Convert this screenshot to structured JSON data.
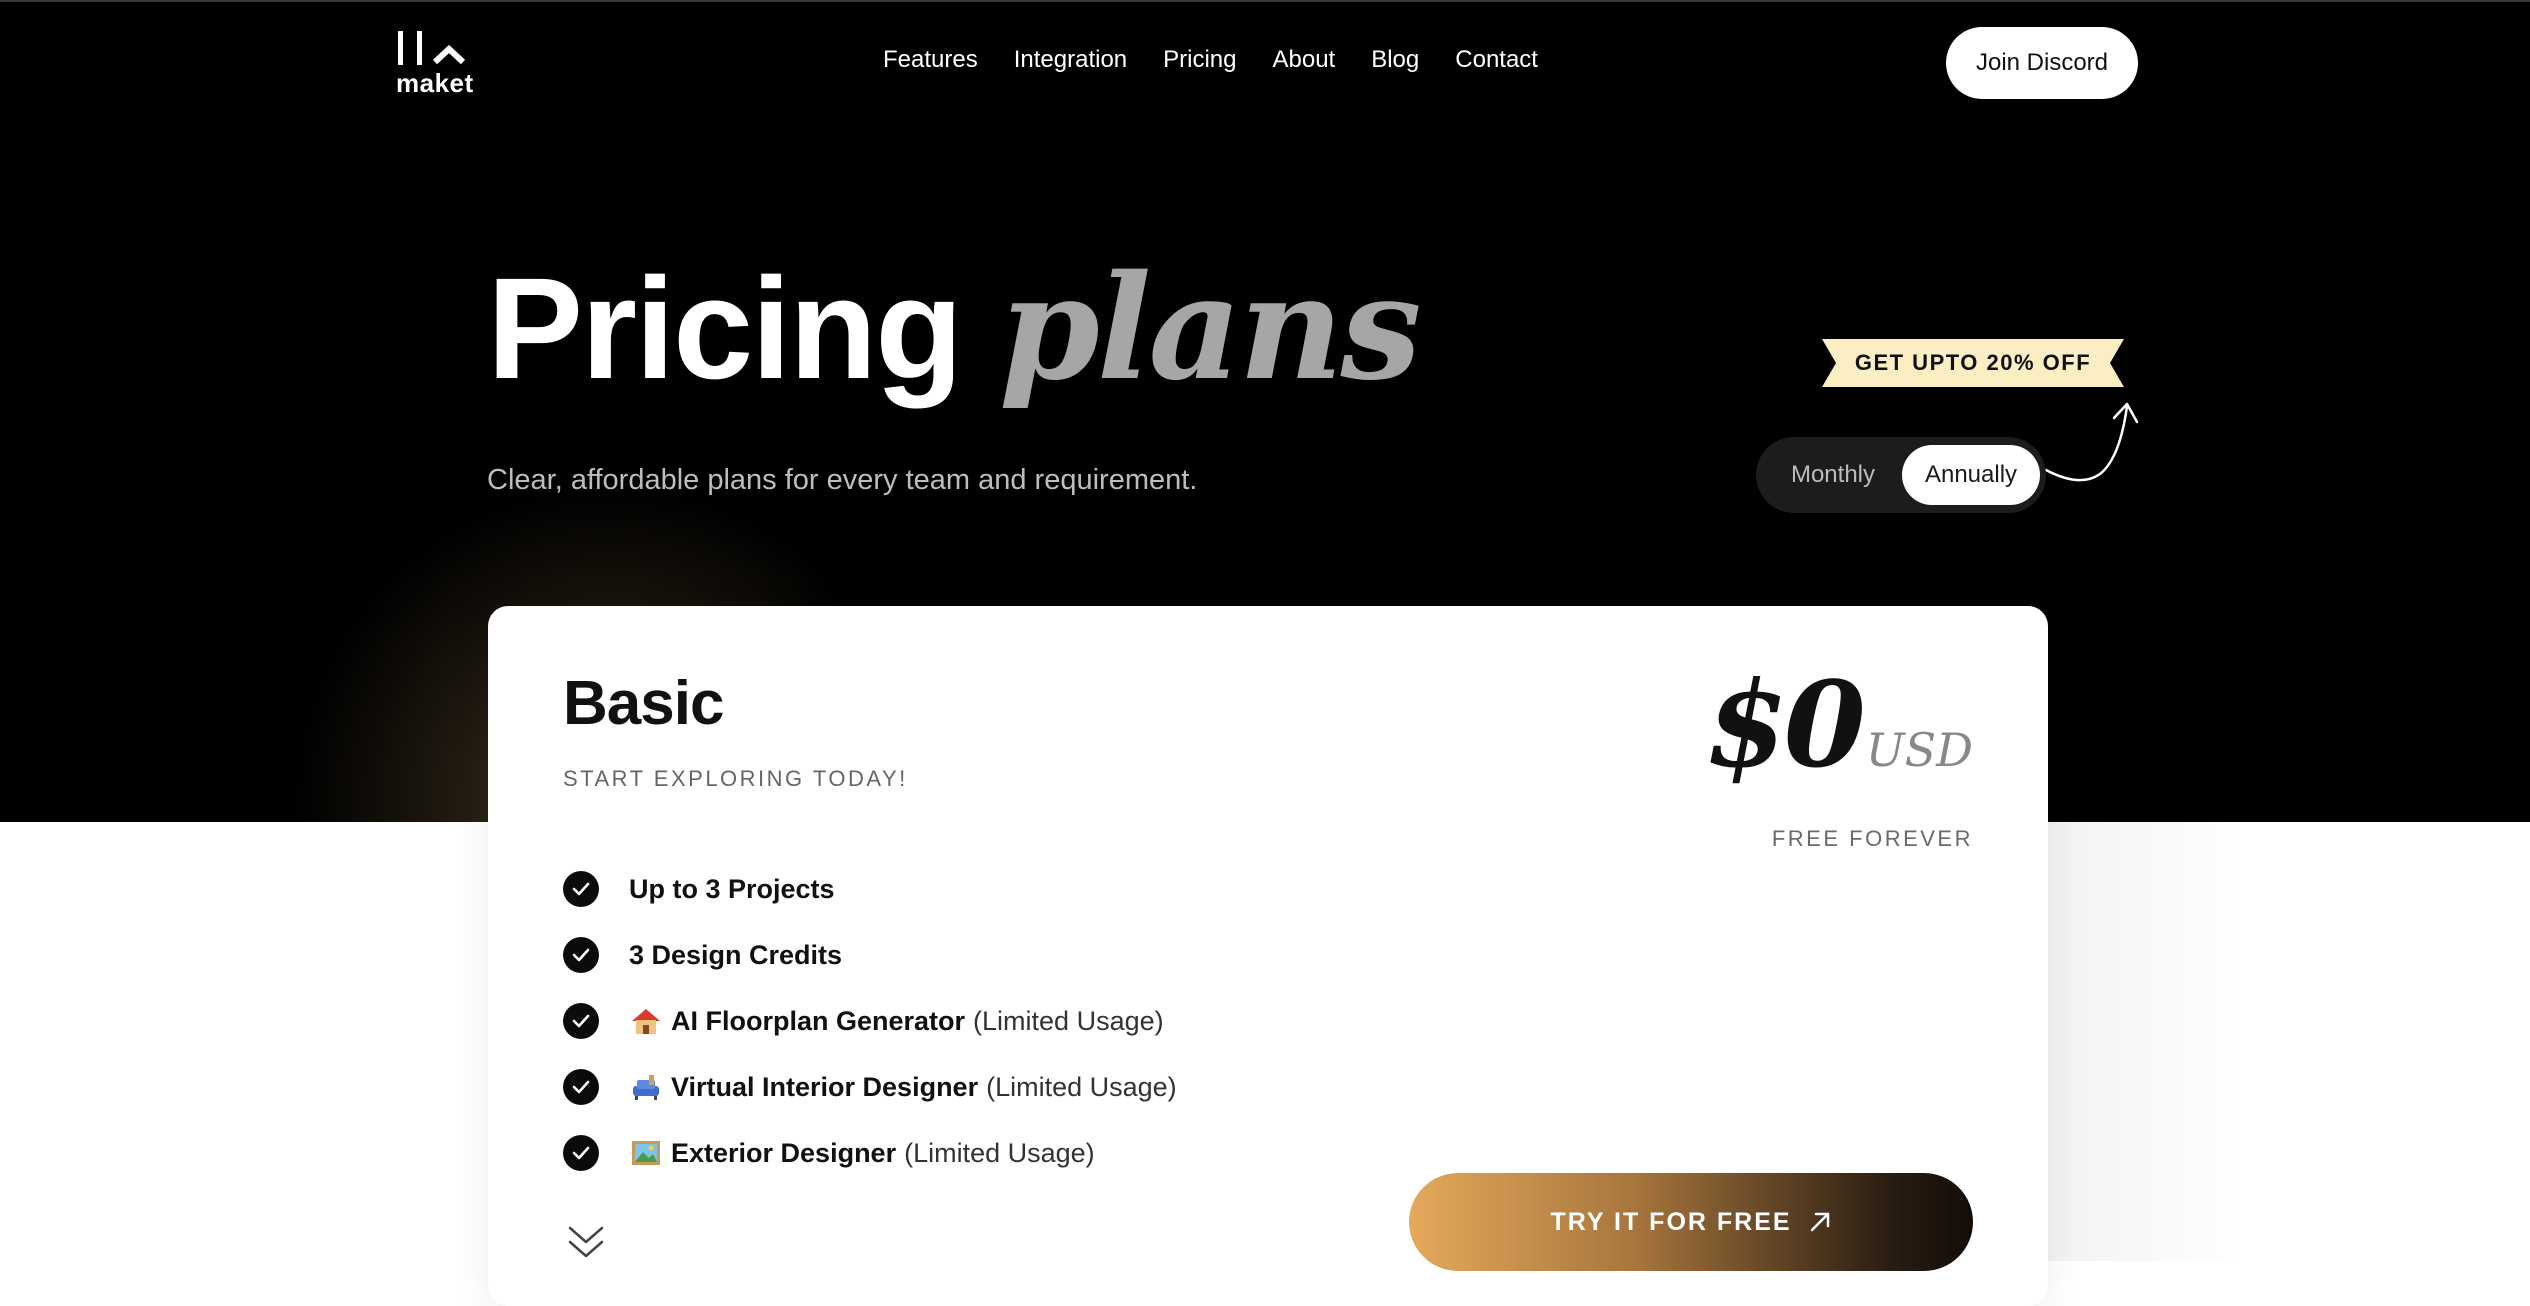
{
  "header": {
    "logo_text": "maket",
    "nav": [
      "Features",
      "Integration",
      "Pricing",
      "About",
      "Blog",
      "Contact"
    ],
    "discord_label": "Join Discord"
  },
  "hero": {
    "title_main": "Pricing",
    "title_accent": "plans",
    "subtitle": "Clear, affordable plans for every team and requirement."
  },
  "billing": {
    "promo": "GET UPTO 20% OFF",
    "options": [
      "Monthly",
      "Annually"
    ],
    "selected": "Annually"
  },
  "plan": {
    "name": "Basic",
    "tagline": "START EXPLORING TODAY!",
    "price": "$0",
    "currency": "USD",
    "price_note": "FREE FOREVER",
    "features": [
      {
        "icon": "",
        "bold": "Up to 3 Projects",
        "light": ""
      },
      {
        "icon": "",
        "bold": "3 Design Credits",
        "light": ""
      },
      {
        "icon": "house-emoji",
        "bold": "AI Floorplan Generator",
        "light": "(Limited Usage)"
      },
      {
        "icon": "couch-emoji",
        "bold": "Virtual Interior Designer",
        "light": "(Limited Usage)"
      },
      {
        "icon": "framed-picture-emoji",
        "bold": "Exterior Designer",
        "light": "(Limited Usage)"
      }
    ],
    "cta_label": "TRY IT FOR FREE"
  },
  "colors": {
    "hero_bg": "#000000",
    "promo_bg": "#fbeec3",
    "cta_gradient_start": "#e4a95b",
    "cta_gradient_end": "#120c08"
  }
}
